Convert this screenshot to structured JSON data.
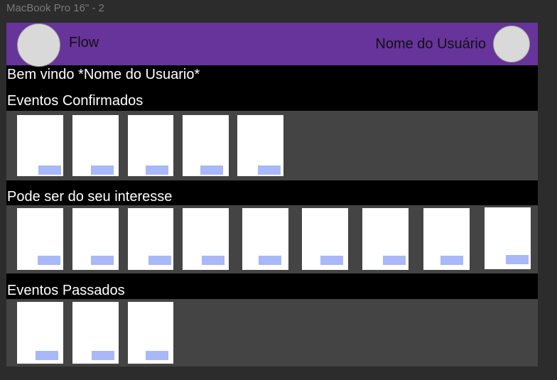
{
  "frame_label": "MacBook Pro 16\" - 2",
  "header": {
    "logo_text": "Flow",
    "user_name": "Nome do Usuário"
  },
  "welcome_text": "Bem vindo *Nome do Usuario*",
  "sections": {
    "confirmed": {
      "title": "Eventos Confirmados",
      "card_count": 5
    },
    "interest": {
      "title": "Pode ser do seu interesse",
      "card_count": 9
    },
    "past": {
      "title": "Eventos Passados",
      "card_count": 3
    }
  },
  "colors": {
    "header_bg": "#66349a",
    "row_bg": "#444444",
    "tag": "#a8b8f8"
  }
}
